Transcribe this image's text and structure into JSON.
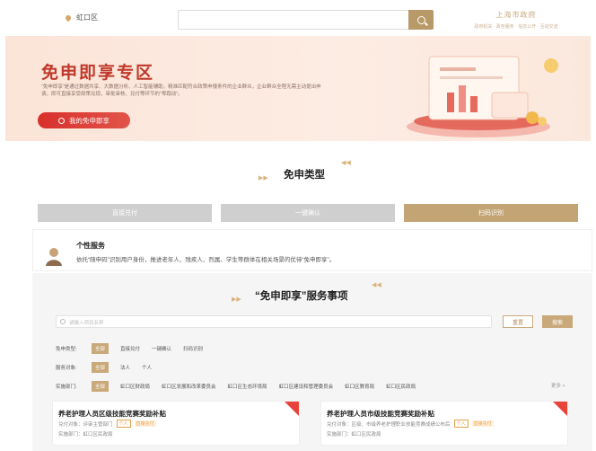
{
  "topbar": {
    "location": "虹口区",
    "search_placeholder": "",
    "brand_title": "上海市政府",
    "brand_sub": "政府机关 · 政务服务 · 信息公开 · 互动交流"
  },
  "banner": {
    "title": "免申即享专区",
    "description": "“免申即享”是通过数据共享、大数据分析、人工智能辅助，精准匹配符合政策申报条件的企业群众，企业群众全程无需主动提出申请，即可直接享受政策兑现，审批审核、兑付等环节的“零跑动”。",
    "button": "我的免申即享"
  },
  "types": {
    "heading": "免申类型",
    "tabs": [
      "直接兑付",
      "一键确认",
      "扫码识别"
    ]
  },
  "personal": {
    "title": "个性服务",
    "desc": "依托“随申码”识别用户身份，推进老年人、残疾人、烈属、学生等群体在相关场景的优待“免申即享”。"
  },
  "services": {
    "heading": "“免申即享”服务事项",
    "search_placeholder": "请输入项目名称",
    "reset": "重置",
    "query": "搜索",
    "filters": [
      {
        "label": "免申类型:",
        "options": [
          "全部",
          "直接兑付",
          "一键确认",
          "扫码识别"
        ],
        "selected": 0
      },
      {
        "label": "服务对象:",
        "options": [
          "全部",
          "法人",
          "个人"
        ],
        "selected": 0
      },
      {
        "label": "实施部门:",
        "options": [
          "全部",
          "虹口区财政局",
          "虹口区发展和改革委员会",
          "虹口区生态环境局",
          "虹口区建设和管理委员会",
          "虹口区教育局",
          "虹口区民政局"
        ],
        "selected": 0
      }
    ],
    "more": "更多 >",
    "cards": [
      {
        "title": "养老护理人员区级技能竞赛奖励补贴",
        "line1": "兑付对象：评审主管部门",
        "tag1": "个人",
        "tag2": "直接兑付",
        "line2": "实施部门：虹口区民政局"
      },
      {
        "title": "养老护理人员市级技能竞赛奖励补贴",
        "line1": "兑付对象：区级、市级养老护理职业技能竞赛成绩公布后",
        "tag1": "个人",
        "tag2": "直接兑付",
        "line2": "实施部门：虹口区民政局"
      }
    ]
  },
  "colors": {
    "accent": "#c9a87a",
    "banner_red": "#c0392b"
  }
}
